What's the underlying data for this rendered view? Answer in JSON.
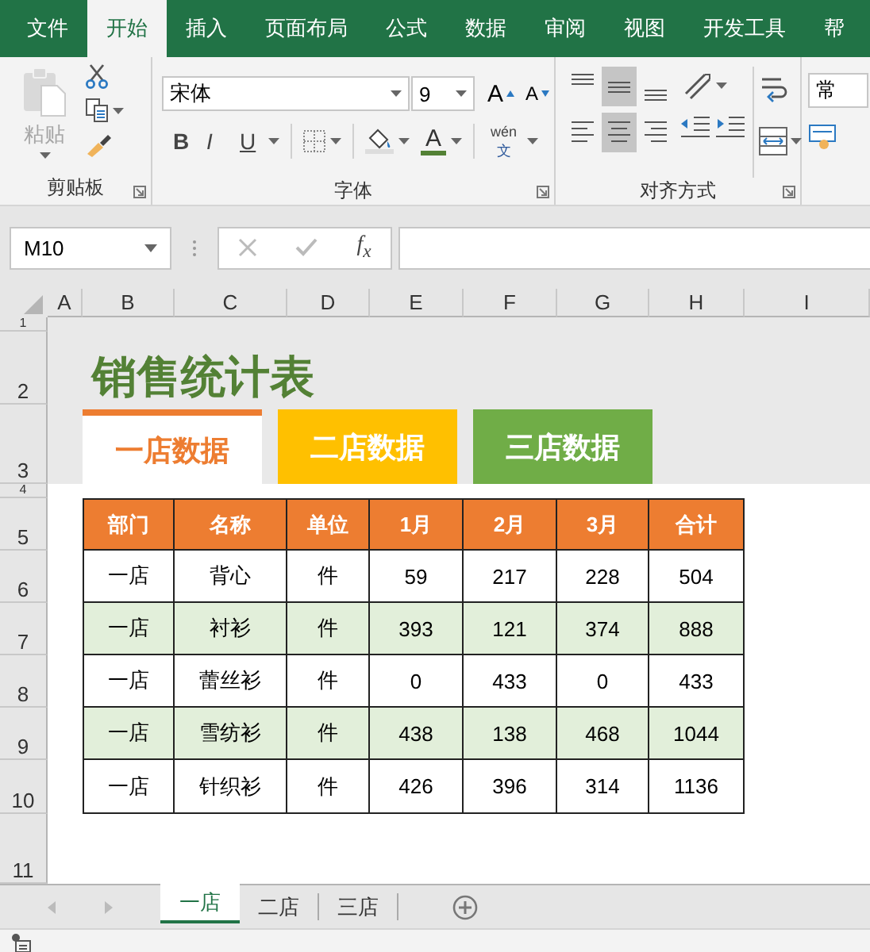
{
  "ribbon_tabs": [
    {
      "label": "文件",
      "selected": false
    },
    {
      "label": "开始",
      "selected": true
    },
    {
      "label": "插入",
      "selected": false
    },
    {
      "label": "页面布局",
      "selected": false
    },
    {
      "label": "公式",
      "selected": false
    },
    {
      "label": "数据",
      "selected": false
    },
    {
      "label": "审阅",
      "selected": false
    },
    {
      "label": "视图",
      "selected": false
    },
    {
      "label": "开发工具",
      "selected": false
    },
    {
      "label": "帮",
      "selected": false
    }
  ],
  "clipboard": {
    "paste": {
      "label": "粘贴",
      "disabled": true
    },
    "group_label": "剪贴板"
  },
  "font": {
    "name": "宋体",
    "size": "9",
    "grow": "A",
    "shrink": "A",
    "styles": [
      {
        "kind": "bold",
        "label": "B"
      },
      {
        "kind": "italic",
        "label": "I"
      },
      {
        "kind": "underline",
        "label": "U"
      }
    ],
    "font_color": "A",
    "phonetic": {
      "top": "wén",
      "bottom": "文"
    },
    "group_label": "字体"
  },
  "alignment": {
    "buttons": [
      {
        "kind": "top",
        "selected": false
      },
      {
        "kind": "middle",
        "selected": true
      },
      {
        "kind": "bottom",
        "selected": false
      },
      {
        "kind": "left",
        "selected": false
      },
      {
        "kind": "center",
        "selected": true
      },
      {
        "kind": "right",
        "selected": false
      }
    ],
    "group_label": "对齐方式"
  },
  "number": {
    "format": "常"
  },
  "formula_bar": {
    "name_box": "M10",
    "function_label": "f$_{x}$"
  },
  "sheet": {
    "columns": [
      "A",
      "B",
      "C",
      "D",
      "E",
      "F",
      "G",
      "H",
      "I"
    ],
    "rows": [
      "1",
      "2",
      "3",
      "4",
      "5",
      "6",
      "7",
      "8",
      "9",
      "10",
      "11"
    ],
    "title": "销售统计表",
    "store_buttons": [
      {
        "label": "一店数据",
        "selected": true,
        "color": "#ffffff"
      },
      {
        "label": "二店数据",
        "selected": false,
        "color": "#ffc000"
      },
      {
        "label": "三店数据",
        "selected": false,
        "color": "#70ad47"
      }
    ],
    "table": {
      "header": [
        "部门",
        "名称",
        "单位",
        "1月",
        "2月",
        "3月",
        "合计"
      ],
      "rows": [
        [
          "一店",
          "背心",
          "件",
          "59",
          "217",
          "228",
          "504"
        ],
        [
          "一店",
          "衬衫",
          "件",
          "393",
          "121",
          "374",
          "888"
        ],
        [
          "一店",
          "蕾丝衫",
          "件",
          "0",
          "433",
          "0",
          "433"
        ],
        [
          "一店",
          "雪纺衫",
          "件",
          "438",
          "138",
          "468",
          "1044"
        ],
        [
          "一店",
          "针织衫",
          "件",
          "426",
          "396",
          "314",
          "1136"
        ]
      ]
    }
  },
  "sheet_tabs": [
    {
      "label": "一店",
      "selected": true
    },
    {
      "label": "二店",
      "selected": false
    },
    {
      "label": "三店",
      "selected": false
    }
  ]
}
